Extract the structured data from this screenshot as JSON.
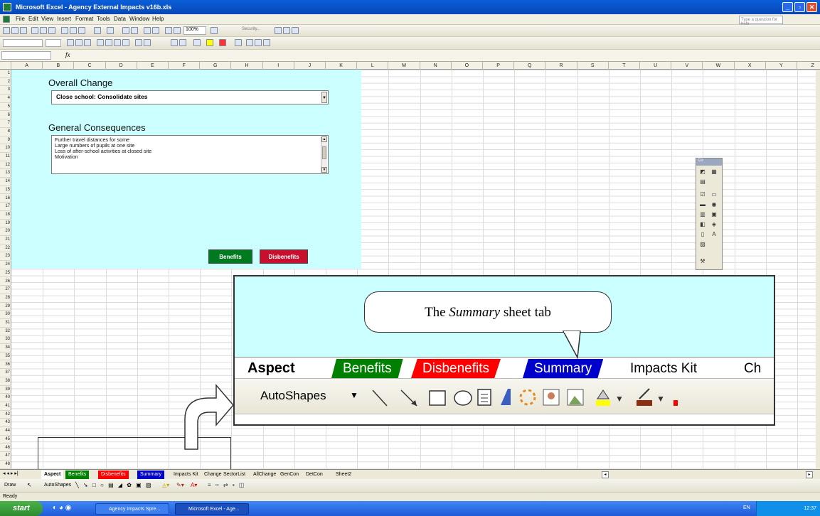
{
  "window": {
    "title": "Microsoft Excel - Agency External Impacts v16b.xls"
  },
  "menu": [
    "File",
    "Edit",
    "View",
    "Insert",
    "Format",
    "Tools",
    "Data",
    "Window",
    "Help"
  ],
  "help_box": {
    "placeholder": "Type a question for help"
  },
  "toolbar": {
    "zoom": "100%",
    "security": "Security..."
  },
  "columns": [
    "A",
    "B",
    "C",
    "D",
    "E",
    "F",
    "G",
    "H",
    "I",
    "J",
    "K",
    "L",
    "M",
    "N",
    "O",
    "P",
    "Q",
    "R",
    "S",
    "T",
    "U",
    "V",
    "W",
    "X",
    "Y",
    "Z"
  ],
  "rows": [
    "1",
    "2",
    "3",
    "4",
    "5",
    "6",
    "7",
    "8",
    "9",
    "10",
    "11",
    "12",
    "13",
    "14",
    "15",
    "16",
    "17",
    "18",
    "19",
    "20",
    "21",
    "22",
    "23",
    "24",
    "25",
    "26",
    "27",
    "28",
    "29",
    "30",
    "31",
    "32",
    "33",
    "34",
    "35",
    "36",
    "37",
    "38",
    "39",
    "40",
    "41",
    "42",
    "43",
    "44",
    "45",
    "46",
    "47",
    "48"
  ],
  "sheet": {
    "overall_change_label": "Overall Change",
    "overall_change_value": "Close school: Consolidate sites",
    "general_consequences_label": "General Consequences",
    "consequences": [
      "Further travel distances for some",
      "Large numbers of pupils at one site",
      "Loss of after-school activities at closed site",
      "Motivation"
    ],
    "benefits_button": "Benefits",
    "disbenefits_button": "Disbenefits"
  },
  "controls_toolbar": {
    "title": "Co"
  },
  "zoom_inset": {
    "callout_pre": "The ",
    "callout_em": "Summary",
    "callout_post": " sheet tab",
    "tabs": [
      "Aspect",
      "Benefits",
      "Disbenefits",
      "Summary",
      "Impacts Kit",
      "Ch"
    ],
    "autoshapes": "AutoShapes"
  },
  "sheet_tabs": [
    "Aspect",
    "Benefits",
    "Disbenefits",
    "Summary",
    "Impacts Kit",
    "Change",
    "SectorList",
    "AllChange",
    "GenCon",
    "DetCon",
    "Sheet2"
  ],
  "tab_colors": {
    "Benefits": "#008000",
    "Disbenefits": "#ff0000",
    "Summary": "#0000cc"
  },
  "draw_toolbar": {
    "draw": "Draw",
    "autoshapes": "AutoShapes"
  },
  "status": "Ready",
  "taskbar": {
    "start": "start",
    "items": [
      "Agency Impacts Spre...",
      "Microsoft Excel - Age..."
    ],
    "lang": "EN",
    "clock": "12:37"
  }
}
